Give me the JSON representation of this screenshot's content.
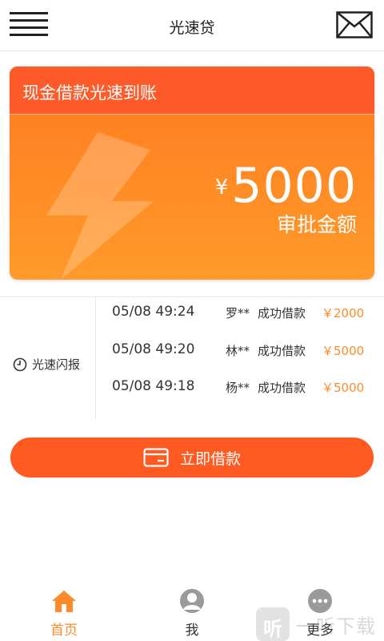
{
  "header": {
    "title": "光速贷",
    "menu_icon": "hamburger-menu-icon",
    "mail_icon": "mail-envelope-icon"
  },
  "hero": {
    "headline": "现金借款光速到账",
    "currency": "¥",
    "amount": "5000",
    "amount_label": "审批金额",
    "colors": {
      "gradient_top": "#ff7a1f",
      "gradient_bottom": "#ff9a2a",
      "header": "#ff5a2a"
    }
  },
  "flash_report": {
    "label": "光速闪报",
    "icon": "clock-icon",
    "rows": [
      {
        "time": "05/08 49:24",
        "name": "罗**",
        "action": "成功借款",
        "amount": "￥2000"
      },
      {
        "time": "05/08 49:20",
        "name": "林**",
        "action": "成功借款",
        "amount": "￥5000"
      },
      {
        "time": "05/08 49:18",
        "name": "杨**",
        "action": "成功借款",
        "amount": "￥5000"
      }
    ]
  },
  "borrow_button": {
    "label": "立即借款",
    "icon": "card-icon",
    "color": "#ff5a22"
  },
  "tabs": [
    {
      "label": "首页",
      "icon": "home-icon",
      "active": true
    },
    {
      "label": "我",
      "icon": "user-avatar-icon",
      "active": false
    },
    {
      "label": "更多",
      "icon": "more-dots-icon",
      "active": false
    }
  ],
  "watermark": {
    "badge": "听",
    "text": "一听下载"
  },
  "accent_color": "#ff8a2a"
}
